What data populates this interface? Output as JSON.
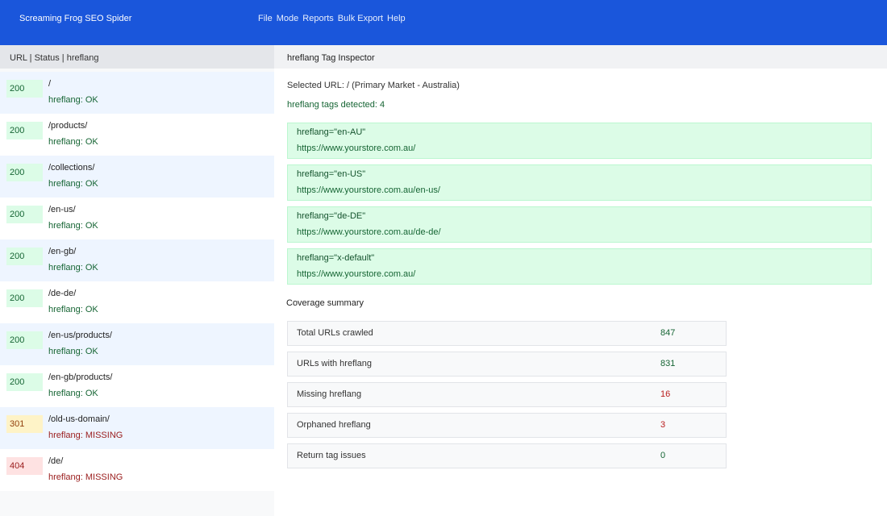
{
  "app": {
    "title": "Screaming Frog SEO Spider"
  },
  "menu": [
    "File",
    "Mode",
    "Reports",
    "Bulk Export",
    "Help"
  ],
  "left": {
    "header": "URL  |  Status  |  hreflang",
    "rows": [
      {
        "code": "200",
        "kind": "ok",
        "url": "/",
        "hreflang": "hreflang: OK",
        "hreflang_ok": true
      },
      {
        "code": "200",
        "kind": "ok",
        "url": "/products/",
        "hreflang": "hreflang: OK",
        "hreflang_ok": true
      },
      {
        "code": "200",
        "kind": "ok",
        "url": "/collections/",
        "hreflang": "hreflang: OK",
        "hreflang_ok": true
      },
      {
        "code": "200",
        "kind": "ok",
        "url": "/en-us/",
        "hreflang": "hreflang: OK",
        "hreflang_ok": true
      },
      {
        "code": "200",
        "kind": "ok",
        "url": "/en-gb/",
        "hreflang": "hreflang: OK",
        "hreflang_ok": true
      },
      {
        "code": "200",
        "kind": "ok",
        "url": "/de-de/",
        "hreflang": "hreflang: OK",
        "hreflang_ok": true
      },
      {
        "code": "200",
        "kind": "ok",
        "url": "/en-us/products/",
        "hreflang": "hreflang: OK",
        "hreflang_ok": true
      },
      {
        "code": "200",
        "kind": "ok",
        "url": "/en-gb/products/",
        "hreflang": "hreflang: OK",
        "hreflang_ok": true
      },
      {
        "code": "301",
        "kind": "redir",
        "url": "/old-us-domain/",
        "hreflang": "hreflang: MISSING",
        "hreflang_ok": false
      },
      {
        "code": "404",
        "kind": "err",
        "url": "/de/",
        "hreflang": "hreflang: MISSING",
        "hreflang_ok": false
      }
    ]
  },
  "inspector": {
    "title": "hreflang Tag Inspector",
    "selected": "Selected URL: /  (Primary Market - Australia)",
    "detected": "hreflang tags detected: 4",
    "tags": [
      {
        "attr": "hreflang=\"en-AU\"",
        "href": "https://www.yourstore.com.au/"
      },
      {
        "attr": "hreflang=\"en-US\"",
        "href": "https://www.yourstore.com.au/en-us/"
      },
      {
        "attr": "hreflang=\"de-DE\"",
        "href": "https://www.yourstore.com.au/de-de/"
      },
      {
        "attr": "hreflang=\"x-default\"",
        "href": "https://www.yourstore.com.au/"
      }
    ],
    "coverage_title": "Coverage summary",
    "coverage": [
      {
        "label": "Total URLs crawled",
        "value": "847",
        "status": "good"
      },
      {
        "label": "URLs with hreflang",
        "value": "831",
        "status": "good"
      },
      {
        "label": "Missing hreflang",
        "value": "16",
        "status": "bad"
      },
      {
        "label": "Orphaned hreflang",
        "value": "3",
        "status": "bad"
      },
      {
        "label": "Return tag issues",
        "value": "0",
        "status": "good"
      }
    ]
  }
}
